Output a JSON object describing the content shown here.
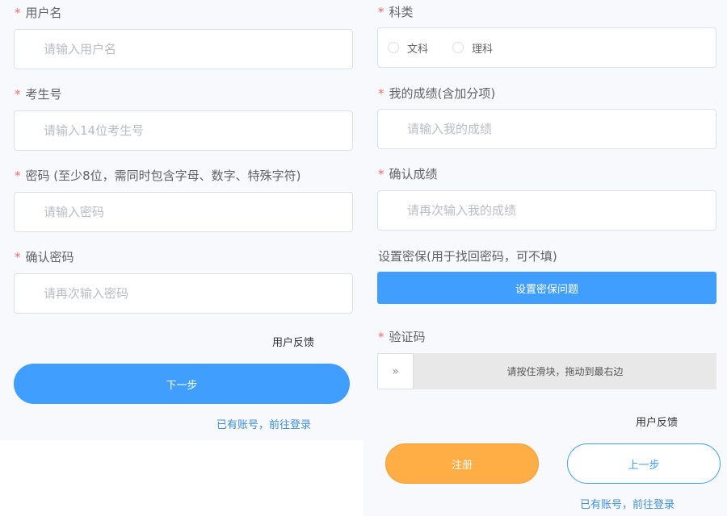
{
  "left": {
    "username": {
      "required": "*",
      "label": "用户名",
      "placeholder": "请输入用户名"
    },
    "exam_no": {
      "required": "*",
      "label": "考生号",
      "placeholder": "请输入14位考生号"
    },
    "password": {
      "required": "*",
      "label": "密码 (至少8位，需同时包含字母、数字、特殊字符)",
      "placeholder": "请输入密码"
    },
    "confirm_password": {
      "required": "*",
      "label": "确认密码",
      "placeholder": "请再次输入密码"
    },
    "feedback": "用户反馈",
    "next_button": "下一步",
    "login_link": "已有账号，前往登录"
  },
  "right": {
    "subject": {
      "required": "*",
      "label": "科类",
      "options": [
        "文科",
        "理科"
      ]
    },
    "score": {
      "required": "*",
      "label": "我的成绩(含加分项)",
      "placeholder": "请输入我的成绩"
    },
    "confirm_score": {
      "required": "*",
      "label": "确认成绩",
      "placeholder": "请再次输入我的成绩"
    },
    "security": {
      "label": "设置密保(用于找回密码，可不填)",
      "button": "设置密保问题"
    },
    "captcha": {
      "required": "*",
      "label": "验证码",
      "handle": "»",
      "hint": "请按住滑块，拖动到最右边"
    },
    "feedback": "用户反馈",
    "register_button": "注册",
    "prev_button": "上一步",
    "login_link": "已有账号，前往登录"
  },
  "colors": {
    "primary": "#409eff",
    "orange": "#ffad45",
    "required": "#f56c6c",
    "link": "#3f8fd8"
  }
}
